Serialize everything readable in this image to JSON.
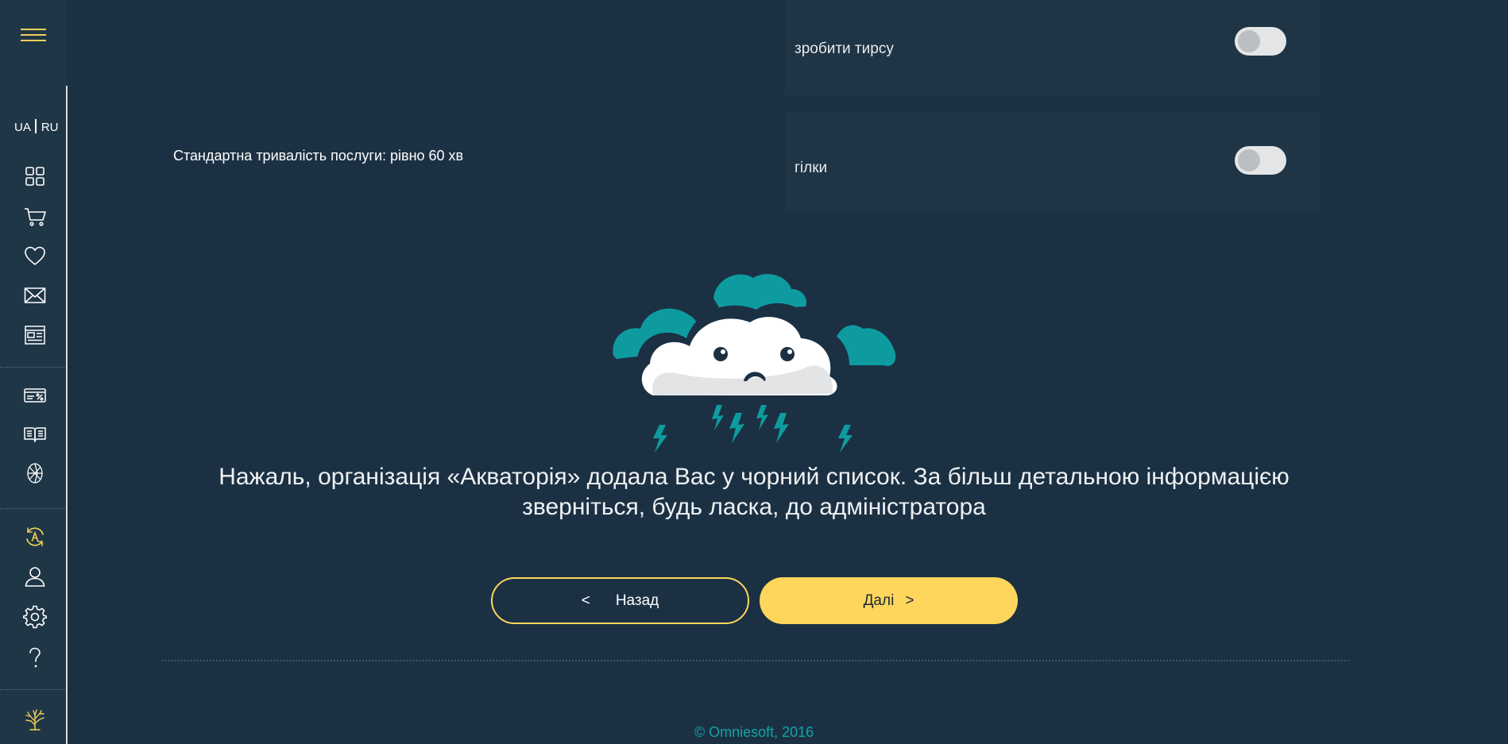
{
  "language_switch": {
    "ua": "UA",
    "ru": "RU"
  },
  "options": [
    {
      "label": "зробити тирсу",
      "enabled": false
    },
    {
      "label": "гілки",
      "enabled": false
    }
  ],
  "service": {
    "duration_text": "Стандартна тривалість послуги: рівно 60 хв"
  },
  "message": {
    "line1": "Нажаль, організація «Акваторія» додала Вас у чорний список. За більш детальною інформацією",
    "line2": "зверніться, будь ласка, до адміністратора"
  },
  "buttons": {
    "back_arrow": "<",
    "back_label": "Назад",
    "next_label": "Далі",
    "next_arrow": ">"
  },
  "footer": {
    "copyright": "© Omniesoft, 2016"
  },
  "sidebar_icons": [
    "menu-icon",
    "dashboard-grid-icon",
    "cart-icon",
    "heart-icon",
    "mail-icon",
    "news-icon",
    "discount-card-icon",
    "book-icon",
    "aperture-icon",
    "sync-account-icon",
    "user-icon",
    "gear-icon",
    "help-icon",
    "tree-logo-icon"
  ],
  "illustration": "sad-storm-cloud",
  "colors": {
    "background": "#1b3143",
    "sidebar": "#1f3646",
    "accent_yellow": "#ffd65c",
    "teal": "#0e9ba0",
    "copyright_teal": "#12a3a8",
    "card": "#1f3545"
  }
}
